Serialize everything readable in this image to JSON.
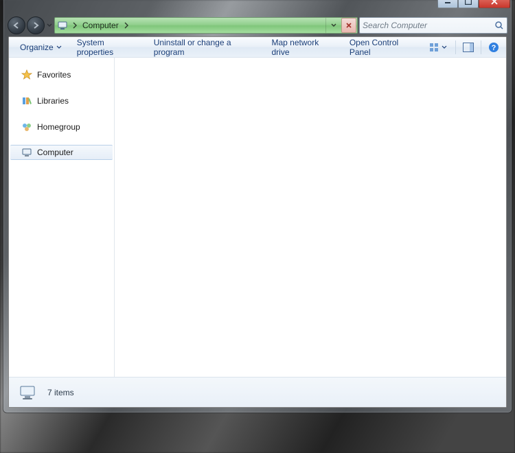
{
  "breadcrumb": {
    "location": "Computer"
  },
  "search": {
    "placeholder": "Search Computer"
  },
  "toolbar": {
    "organize": "Organize",
    "system_properties": "System properties",
    "uninstall": "Uninstall or change a program",
    "map_drive": "Map network drive",
    "control_panel": "Open Control Panel"
  },
  "nav": {
    "favorites": "Favorites",
    "libraries": "Libraries",
    "homegroup": "Homegroup",
    "computer": "Computer"
  },
  "status": {
    "text": "7 items"
  }
}
